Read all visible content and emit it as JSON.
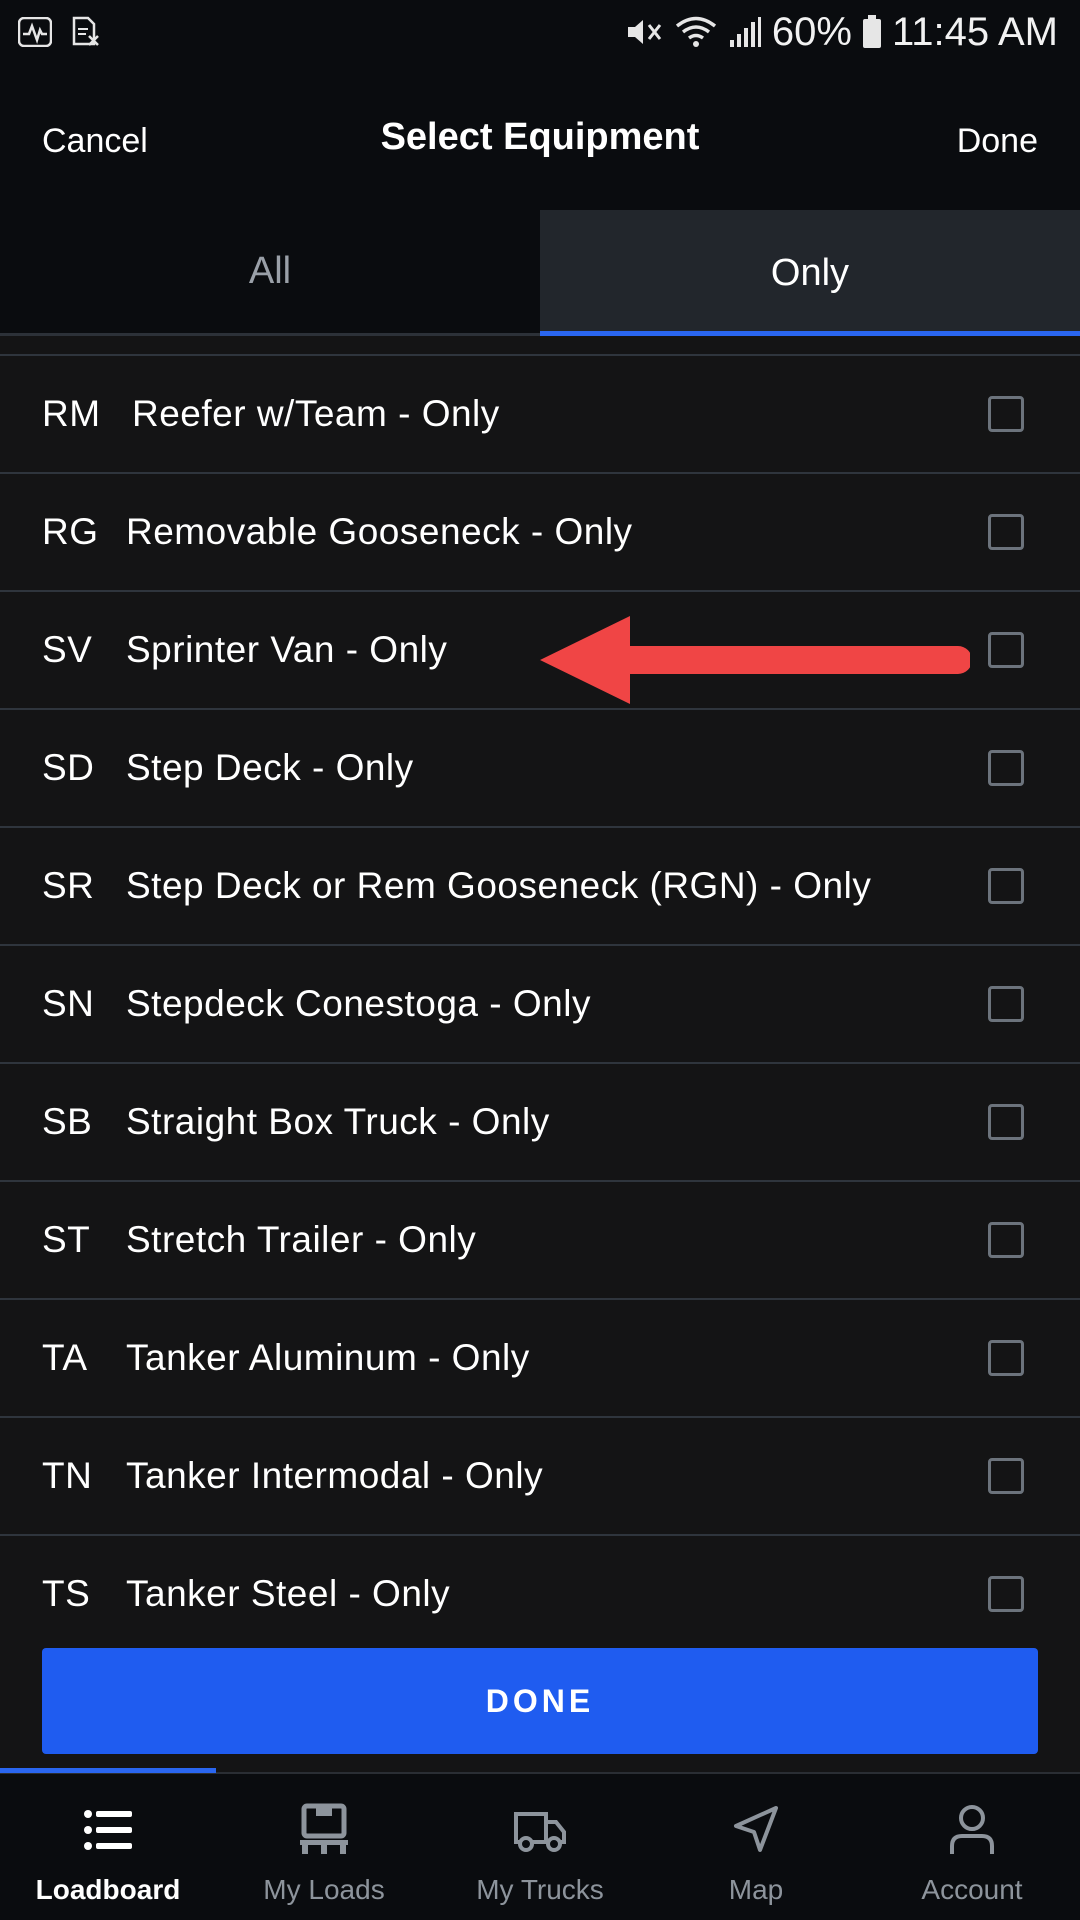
{
  "status_bar": {
    "battery_percent": "60%",
    "time": "11:45 AM"
  },
  "header": {
    "cancel_label": "Cancel",
    "title": "Select Equipment",
    "done_label": "Done"
  },
  "tabs": [
    {
      "label": "All",
      "selected": false
    },
    {
      "label": "Only",
      "selected": true
    }
  ],
  "equipment": [
    {
      "code": "RM",
      "label": "Reefer w/Team - Only",
      "checked": false
    },
    {
      "code": "RG",
      "label": "Removable Gooseneck - Only",
      "checked": false
    },
    {
      "code": "SV",
      "label": "Sprinter Van - Only",
      "checked": false
    },
    {
      "code": "SD",
      "label": "Step Deck - Only",
      "checked": false
    },
    {
      "code": "SR",
      "label": "Step Deck or Rem Gooseneck (RGN) - Only",
      "checked": false
    },
    {
      "code": "SN",
      "label": "Stepdeck Conestoga - Only",
      "checked": false
    },
    {
      "code": "SB",
      "label": "Straight Box Truck - Only",
      "checked": false
    },
    {
      "code": "ST",
      "label": "Stretch Trailer - Only",
      "checked": false
    },
    {
      "code": "TA",
      "label": "Tanker Aluminum - Only",
      "checked": false
    },
    {
      "code": "TN",
      "label": "Tanker Intermodal - Only",
      "checked": false
    },
    {
      "code": "TS",
      "label": "Tanker Steel - Only",
      "checked": false
    }
  ],
  "done_button_label": "DONE",
  "bottom_nav": [
    {
      "label": "Loadboard",
      "icon": "list-icon",
      "active": true
    },
    {
      "label": "My Loads",
      "icon": "pallet-icon",
      "active": false
    },
    {
      "label": "My Trucks",
      "icon": "truck-icon",
      "active": false
    },
    {
      "label": "Map",
      "icon": "navigation-arrow-icon",
      "active": false
    },
    {
      "label": "Account",
      "icon": "person-icon",
      "active": false
    }
  ],
  "colors": {
    "accent": "#1f5cf0",
    "background": "#141415",
    "header_background": "#0a0c0f",
    "annotation_arrow": "#f04545"
  }
}
